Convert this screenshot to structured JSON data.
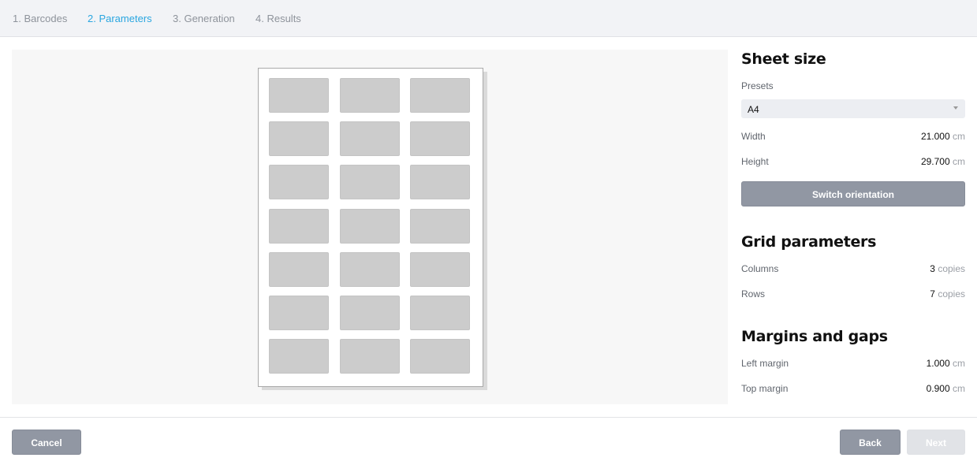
{
  "steps": [
    {
      "label": "1. Barcodes"
    },
    {
      "label": "2. Parameters",
      "active": true
    },
    {
      "label": "3. Generation"
    },
    {
      "label": "4. Results"
    }
  ],
  "preview": {
    "columns": 3,
    "rows": 7
  },
  "sheet_size": {
    "title": "Sheet size",
    "presets_label": "Presets",
    "preset_value": "A4",
    "width_label": "Width",
    "width_value": "21.000",
    "height_label": "Height",
    "height_value": "29.700",
    "unit": "cm",
    "switch_label": "Switch orientation"
  },
  "grid": {
    "title": "Grid parameters",
    "columns_label": "Columns",
    "columns_value": "3",
    "rows_label": "Rows",
    "rows_value": "7",
    "unit": "copies"
  },
  "margins": {
    "title": "Margins and gaps",
    "left_label": "Left margin",
    "left_value": "1.000",
    "top_label": "Top margin",
    "top_value": "0.900",
    "unit": "cm"
  },
  "footer": {
    "cancel": "Cancel",
    "back": "Back",
    "next": "Next"
  },
  "colors": {
    "accent": "#2aa6e0",
    "button": "#9197a3",
    "button_disabled": "#e1e3e7"
  }
}
